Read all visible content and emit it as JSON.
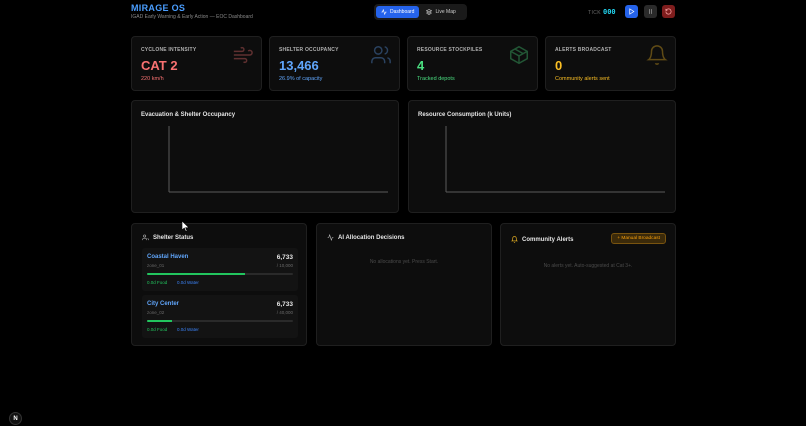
{
  "header": {
    "title": "MIRAGE OS",
    "subtitle": "IGAD Early Warning & Early Action — EOC Dashboard",
    "nav": [
      {
        "label": "Dashboard",
        "icon": "activity-icon",
        "active": true
      },
      {
        "label": "Live Map",
        "icon": "layers-icon",
        "active": false
      }
    ],
    "tick_label": "TICK",
    "tick_value": "000"
  },
  "stats": [
    {
      "label": "CYCLONE INTENSITY",
      "value": "CAT 2",
      "sub": "220 km/h",
      "color": "#f87171",
      "icon": "wind-icon"
    },
    {
      "label": "SHELTER OCCUPANCY",
      "value": "13,466",
      "sub": "26.9% of capacity",
      "color": "#60a5fa",
      "icon": "users-icon"
    },
    {
      "label": "RESOURCE STOCKPILES",
      "value": "4",
      "sub": "Tracked depots",
      "color": "#4ade80",
      "icon": "package-icon"
    },
    {
      "label": "ALERTS BROADCAST",
      "value": "0",
      "sub": "Community alerts sent",
      "color": "#fbbf24",
      "icon": "bell-icon"
    }
  ],
  "charts": {
    "evacuation_title": "Evacuation & Shelter Occupancy",
    "resource_title": "Resource Consumption (k Units)"
  },
  "shelter_panel": {
    "title": "Shelter Status",
    "shelters": [
      {
        "name": "Coastal Haven",
        "zone": "zone_01",
        "occupancy": "6,733",
        "capacity": "/ 10,000",
        "fill": 0.673,
        "food": "0.0d Food",
        "water": "0.0d Water"
      },
      {
        "name": "City Center",
        "zone": "zone_02",
        "occupancy": "6,733",
        "capacity": "/ 40,000",
        "fill": 0.168,
        "food": "0.0d Food",
        "water": "0.0d Water"
      }
    ]
  },
  "ai_panel": {
    "title": "AI Allocation Decisions",
    "empty": "No allocations yet. Press Start."
  },
  "alerts_panel": {
    "title": "Community Alerts",
    "button": "+ Manual Broadcast",
    "empty": "No alerts yet. Auto-suggested at Cat 3+."
  },
  "logo_letter": "N"
}
